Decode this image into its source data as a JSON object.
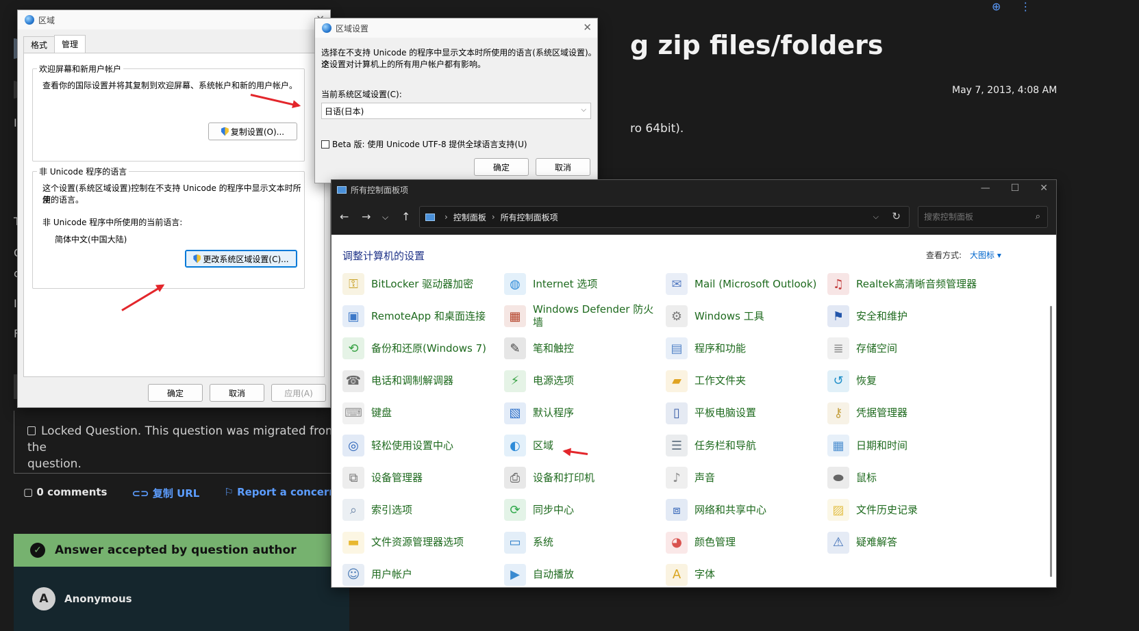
{
  "background_page": {
    "title_partial": "g zip files/folders",
    "date": "May 7, 2013, 4:08 AM",
    "os_partial": "ro 64bit).",
    "side_letters": [
      "I",
      "T",
      "C",
      "c",
      "I",
      "F"
    ],
    "locked_text": "Locked Question. This question was migrated from the",
    "locked_text_2": "question.",
    "comments": "0 comments",
    "copy_url": "复制 URL",
    "report": "Report a concern",
    "answer_banner": "Answer accepted by question author",
    "answer_author_initial": "A",
    "answer_author": "Anonymous",
    "colors": {
      "answer_banner": "#76b26f",
      "link": "#5c9dff"
    }
  },
  "region_dialog": {
    "title": "区域",
    "tabs": [
      "格式",
      "管理"
    ],
    "group1_label": "欢迎屏幕和新用户帐户",
    "group1_text": "查看你的国际设置并将其复制到欢迎屏幕、系统帐户和新的用户帐户。",
    "copy_button": "复制设置(O)...",
    "group2_label": "非 Unicode 程序的语言",
    "group2_text_1": "这个设置(系统区域设置)控制在不支持 Unicode 的程序中显示文本时所使",
    "group2_text_2": "用的语言。",
    "current_label": "非 Unicode 程序中所使用的当前语言:",
    "current_value": "简体中文(中国大陆)",
    "change_button": "更改系统区域设置(C)...",
    "ok": "确定",
    "cancel": "取消",
    "apply": "应用(A)"
  },
  "region_settings_dialog": {
    "title": "区域设置",
    "desc_1": "选择在不支持 Unicode 的程序中显示文本时所使用的语言(系统区域设置)。这",
    "desc_2": "个设置对计算机上的所有用户帐户都有影响。",
    "current_label": "当前系统区域设置(C):",
    "current_value": "日语(日本)",
    "beta_label": "Beta 版: 使用 Unicode UTF-8 提供全球语言支持(U)",
    "ok": "确定",
    "cancel": "取消"
  },
  "control_panel": {
    "title": "所有控制面板项",
    "breadcrumb": [
      "控制面板",
      "所有控制面板项"
    ],
    "search_placeholder": "搜索控制面板",
    "heading": "调整计算机的设置",
    "view_label": "查看方式:",
    "view_value": "大图标",
    "items": [
      [
        "BitLocker 驱动器加密",
        "Internet 选项",
        "Mail (Microsoft Outlook)",
        "Realtek高清晰音频管理器"
      ],
      [
        "RemoteApp 和桌面连接",
        "Windows Defender 防火墙",
        "Windows 工具",
        "安全和维护"
      ],
      [
        "备份和还原(Windows 7)",
        "笔和触控",
        "程序和功能",
        "存储空间"
      ],
      [
        "电话和调制解调器",
        "电源选项",
        "工作文件夹",
        "恢复"
      ],
      [
        "键盘",
        "默认程序",
        "平板电脑设置",
        "凭据管理器"
      ],
      [
        "轻松使用设置中心",
        "区域",
        "任务栏和导航",
        "日期和时间"
      ],
      [
        "设备管理器",
        "设备和打印机",
        "声音",
        "鼠标"
      ],
      [
        "索引选项",
        "同步中心",
        "网络和共享中心",
        "文件历史记录"
      ],
      [
        "文件资源管理器选项",
        "系统",
        "颜色管理",
        "疑难解答"
      ],
      [
        "用户帐户",
        "自动播放",
        "字体"
      ]
    ],
    "icons": [
      [
        "key-icon",
        "globe-check-icon",
        "mail-icon",
        "audio-icon"
      ],
      [
        "remote-desktop-icon",
        "firewall-icon",
        "gear-tools-icon",
        "flag-icon"
      ],
      [
        "backup-icon",
        "pen-icon",
        "programs-icon",
        "storage-icon"
      ],
      [
        "phone-icon",
        "power-icon",
        "folder-icon",
        "recovery-icon"
      ],
      [
        "keyboard-icon",
        "default-programs-icon",
        "tablet-icon",
        "credential-icon"
      ],
      [
        "ease-of-access-icon",
        "region-globe-icon",
        "taskbar-icon",
        "calendar-clock-icon"
      ],
      [
        "device-manager-icon",
        "printer-icon",
        "speaker-icon",
        "mouse-icon"
      ],
      [
        "search-index-icon",
        "sync-icon",
        "network-icon",
        "file-history-icon"
      ],
      [
        "folder-options-icon",
        "system-icon",
        "color-icon",
        "troubleshoot-icon"
      ],
      [
        "users-icon",
        "autoplay-icon",
        "font-icon"
      ]
    ],
    "icon_colors": [
      [
        "#c9a227",
        "#2e8bd8",
        "#5a7fc4",
        "#c23b3b"
      ],
      [
        "#3c78c8",
        "#b5442b",
        "#7a7a7a",
        "#2255aa"
      ],
      [
        "#3aa346",
        "#444444",
        "#5686c9",
        "#8c8c8c"
      ],
      [
        "#6b6b6b",
        "#3aa346",
        "#e0a320",
        "#1f8fc9"
      ],
      [
        "#999999",
        "#2c6fc9",
        "#3a5ea8",
        "#c5a040"
      ],
      [
        "#2962b8",
        "#2e8bd8",
        "#607080",
        "#4d8fd0"
      ],
      [
        "#777777",
        "#555555",
        "#8a8a8a",
        "#666666"
      ],
      [
        "#6c86a8",
        "#2fa84a",
        "#2c5fb5",
        "#e3c04a"
      ],
      [
        "#e8b830",
        "#2a7dc9",
        "#d9534f",
        "#3a6bb5"
      ],
      [
        "#4a7ab5",
        "#3a8ad0",
        "#d9a520"
      ]
    ]
  }
}
